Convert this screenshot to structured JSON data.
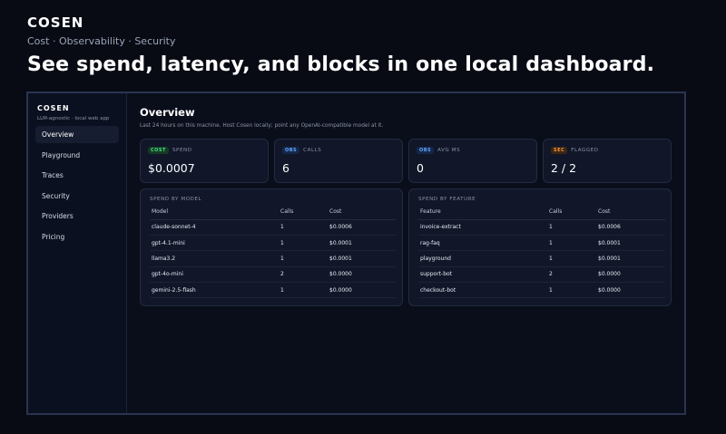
{
  "hero": {
    "brand": "COSEN",
    "tagline": "Cost · Observability · Security",
    "headline": "See spend, latency, and blocks in one local dashboard."
  },
  "sidebar": {
    "brand": "COSEN",
    "subtitle": "LLM-agnostic · local web app",
    "items": [
      {
        "label": "Overview",
        "active": true
      },
      {
        "label": "Playground"
      },
      {
        "label": "Traces"
      },
      {
        "label": "Security"
      },
      {
        "label": "Providers"
      },
      {
        "label": "Pricing"
      }
    ]
  },
  "main": {
    "title": "Overview",
    "subtitle": "Last 24 hours on this machine. Host Cosen locally; point any OpenAI-compatible model at it."
  },
  "stats": [
    {
      "badge": "COST",
      "label": "SPEND",
      "value": "$0.0007",
      "color": "#4ade80"
    },
    {
      "badge": "OBS",
      "label": "CALLS",
      "value": "6",
      "color": "#60a5fa"
    },
    {
      "badge": "OBS",
      "label": "AVG MS",
      "value": "0",
      "color": "#60a5fa"
    },
    {
      "badge": "SEC",
      "label": "FLAGGED",
      "value": "2 / 2",
      "color": "#fb923c"
    }
  ],
  "spend_by_model": {
    "title": "SPEND BY MODEL",
    "headers": [
      "Model",
      "Calls",
      "Cost"
    ],
    "rows": [
      [
        "claude-sonnet-4",
        "1",
        "$0.0006"
      ],
      [
        "gpt-4.1-mini",
        "1",
        "$0.0001"
      ],
      [
        "llama3.2",
        "1",
        "$0.0001"
      ],
      [
        "gpt-4o-mini",
        "2",
        "$0.0000"
      ],
      [
        "gemini-2.5-flash",
        "1",
        "$0.0000"
      ]
    ]
  },
  "spend_by_feature": {
    "title": "SPEND BY FEATURE",
    "headers": [
      "Feature",
      "Calls",
      "Cost"
    ],
    "rows": [
      [
        "invoice-extract",
        "1",
        "$0.0006"
      ],
      [
        "rag-faq",
        "1",
        "$0.0001"
      ],
      [
        "playground",
        "1",
        "$0.0001"
      ],
      [
        "support-bot",
        "2",
        "$0.0000"
      ],
      [
        "checkout-bot",
        "1",
        "$0.0000"
      ]
    ]
  }
}
